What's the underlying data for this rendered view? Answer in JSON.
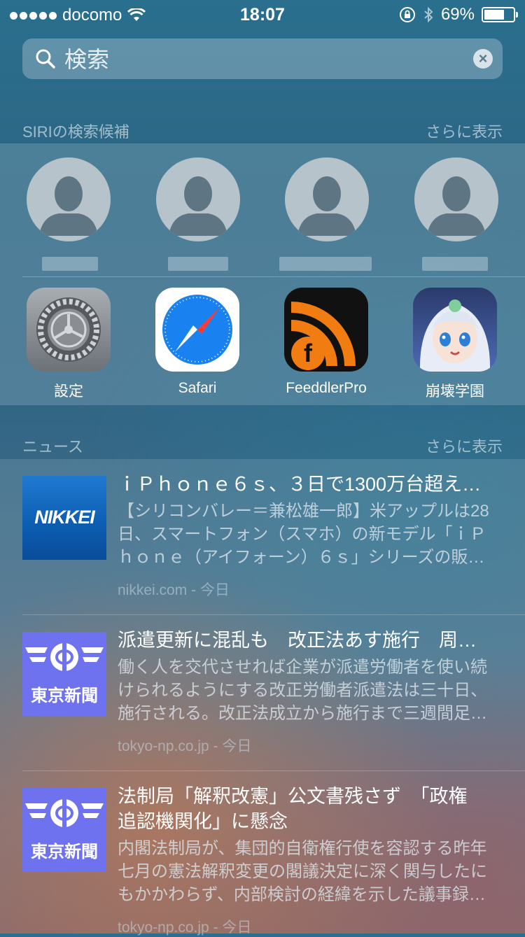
{
  "status": {
    "carrier": "docomo",
    "time": "18:07",
    "battery": "69%",
    "battery_level": 0.69
  },
  "search": {
    "placeholder": "検索"
  },
  "siri": {
    "section_title": "SIRIの検索候補",
    "more_label": "さらに表示",
    "apps": [
      {
        "label": "設定",
        "icon": "settings-gear-icon"
      },
      {
        "label": "Safari",
        "icon": "safari-compass-icon"
      },
      {
        "label": "FeeddlerPro",
        "icon": "feeddler-rss-icon"
      },
      {
        "label": "崩壊学園",
        "icon": "anime-character-icon"
      }
    ]
  },
  "news": {
    "section_title": "ニュース",
    "more_label": "さらに表示",
    "items": [
      {
        "logo_text": "NIKKEI",
        "title": "ｉＰｈｏｎｅ６ｓ、３日で1300万台超え…",
        "desc": [
          "【シリコンバレー＝兼松雄一郎】米アップルは28",
          "日、スマートフォン（スマホ）の新モデル「ｉＰ",
          "ｈｏｎｅ（アイフォーン）６ｓ」シリーズの販…"
        ],
        "source": "nikkei.com - 今日"
      },
      {
        "logo_text": "東京新聞",
        "title": "派遣更新に混乱も　改正法あす施行　周…",
        "desc": [
          "働く人を交代させれば企業が派遣労働者を使い続",
          "けられるようにする改正労働者派遣法は三十日、",
          "施行される。改正法成立から施行まで三週間足…"
        ],
        "source": "tokyo-np.co.jp - 今日"
      },
      {
        "logo_text": "東京新聞",
        "title_lines": [
          "法制局「解釈改憲」公文書残さず　「政権",
          "追認機関化」に懸念"
        ],
        "desc": [
          "内閣法制局が、集団的自衛権行使を容認する昨年",
          "七月の憲法解釈変更の閣議決定に深く関与したに",
          "もかかわらず、内部検討の経緯を示した議事録…"
        ],
        "source": "tokyo-np.co.jp - 今日"
      }
    ]
  }
}
